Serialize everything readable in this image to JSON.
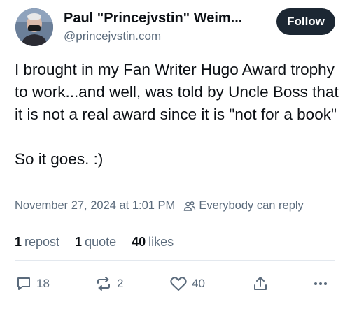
{
  "author": {
    "display_name": "Paul \"Princejvstin\" Weim...",
    "handle": "@princejvstin.com"
  },
  "follow_label": "Follow",
  "post": {
    "text": "I brought in my Fan Writer Hugo Award trophy to work...and well, was told by Uncle Boss that it is not a real award since it is \"not for a book\"\n\nSo it goes. :)",
    "timestamp": "November 27, 2024 at 1:01 PM",
    "reply_setting": "Everybody can reply"
  },
  "stats": {
    "reposts_count": "1",
    "reposts_label": "repost",
    "quotes_count": "1",
    "quotes_label": "quote",
    "likes_count": "40",
    "likes_label": "likes"
  },
  "actions": {
    "reply_count": "18",
    "repost_count": "2",
    "like_count": "40"
  },
  "icons": {
    "reply": "speech-bubble-icon",
    "repost": "repost-arrows-icon",
    "like": "heart-icon",
    "share": "share-upload-icon",
    "more": "ellipsis-icon",
    "audience": "people-icon"
  },
  "colors": {
    "text": "#0b0f14",
    "muted": "#5b6b7c",
    "follow_bg": "#1c2733",
    "divider": "#e3e8ee"
  }
}
